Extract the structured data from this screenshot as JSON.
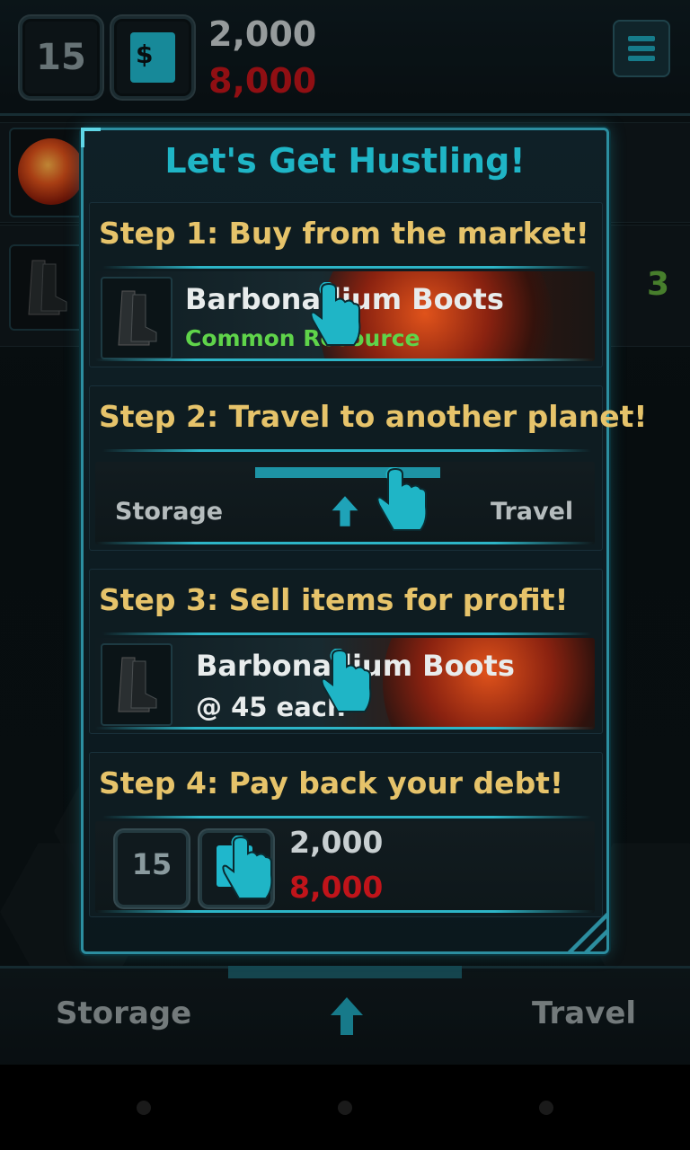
{
  "hud": {
    "level": "15",
    "cash": "2,000",
    "debt": "8,000",
    "money_icon": "dollar-receipt-icon",
    "menu_icon": "hamburger-menu-icon"
  },
  "background_list": {
    "row2_count": "3"
  },
  "bottom_nav": {
    "left_label": "Storage",
    "right_label": "Travel",
    "center_icon": "up-arrow-icon"
  },
  "tutorial": {
    "title": "Let's Get Hustling!",
    "step1": {
      "title": "Step 1: Buy from the market!",
      "item_name": "Barbonadium Boots",
      "item_sub": "Common Resource"
    },
    "step2": {
      "title": "Step 2: Travel to another planet!",
      "left_label": "Storage",
      "right_label": "Travel"
    },
    "step3": {
      "title": "Step 3: Sell items for profit!",
      "item_name": "Barbonadium Boots",
      "item_sub": "@ 45 each"
    },
    "step4": {
      "title": "Step 4: Pay back your debt!",
      "level": "15",
      "cash": "2,000",
      "debt": "8,000"
    }
  },
  "colors": {
    "accent_cyan": "#1fb5c6",
    "step_gold": "#e6c36a",
    "debt_red": "#c0141a",
    "rarity_green": "#5fd44a",
    "count_green": "#5fa83b"
  }
}
